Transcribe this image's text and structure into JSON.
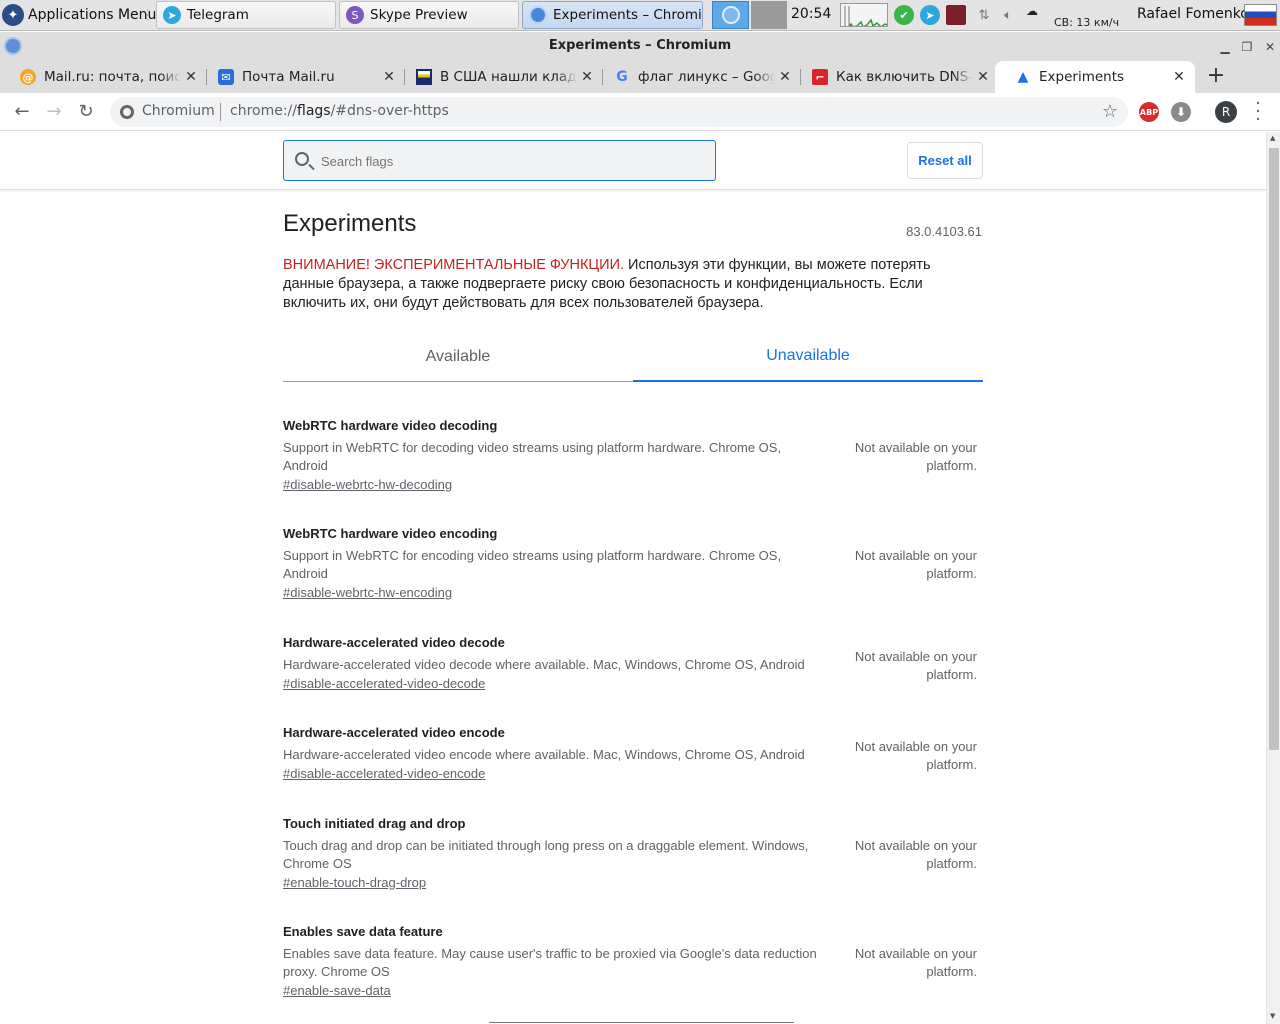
{
  "panel": {
    "app_menu": "Applications Menu",
    "tasks": [
      {
        "label": "Telegram",
        "icon": "telegram-icon"
      },
      {
        "label": "Skype Preview",
        "icon": "skype-icon"
      },
      {
        "label": "Experiments – Chromi...",
        "icon": "chromium-icon"
      }
    ],
    "clock": "20:54",
    "weather": "СВ: 13 км/ч",
    "user": "Rafael Fomenko"
  },
  "window": {
    "title": "Experiments – Chromium"
  },
  "tabs": [
    {
      "label": "Mail.ru: почта, поиск в интернете",
      "icon": "mailru-icon"
    },
    {
      "label": "Почта Mail.ru",
      "icon": "mail-envelope-icon"
    },
    {
      "label": "В США нашли клад на",
      "icon": "news-icon"
    },
    {
      "label": "флаг линукс – Google",
      "icon": "google-icon"
    },
    {
      "label": "Как включить DNS-over-HTTPS",
      "icon": "article-icon"
    },
    {
      "label": "Experiments",
      "icon": "flask-icon",
      "active": true
    }
  ],
  "toolbar": {
    "site": "Chromium",
    "url_prefix": "chrome://",
    "url_host": "flags",
    "url_rest": "/#dns-over-https",
    "avatar_letter": "R",
    "adblock": "ABP"
  },
  "flags_page": {
    "search_placeholder": "Search flags",
    "reset_label": "Reset all",
    "title": "Experiments",
    "version": "83.0.4103.61",
    "warning_red": "ВНИМАНИЕ! ЭКСПЕРИМЕНТАЛЬНЫЕ ФУНКЦИИ.",
    "warning_text": " Используя эти функции, вы можете потерять данные браузера, а также подвергаете риску свою безопасность и конфиденциальность. Если включить их, они будут действовать для всех пользователей браузера.",
    "tab_available": "Available",
    "tab_unavailable": "Unavailable",
    "flags": [
      {
        "name": "WebRTC hardware video decoding",
        "description": "Support in WebRTC for decoding video streams using platform hardware. Chrome OS, Android",
        "link": "#disable-webrtc-hw-decoding",
        "status": "Not available on your platform."
      },
      {
        "name": "WebRTC hardware video encoding",
        "description": "Support in WebRTC for encoding video streams using platform hardware. Chrome OS, Android",
        "link": "#disable-webrtc-hw-encoding",
        "status": "Not available on your platform."
      },
      {
        "name": "Hardware-accelerated video decode",
        "description": "Hardware-accelerated video decode where available. Mac, Windows, Chrome OS, Android",
        "link": "#disable-accelerated-video-decode",
        "status": "Not available on your platform."
      },
      {
        "name": "Hardware-accelerated video encode",
        "description": "Hardware-accelerated video encode where available. Mac, Windows, Chrome OS, Android",
        "link": "#disable-accelerated-video-encode",
        "status": "Not available on your platform."
      },
      {
        "name": "Touch initiated drag and drop",
        "description": "Touch drag and drop can be initiated through long press on a draggable element. Windows, Chrome OS",
        "link": "#enable-touch-drag-drop",
        "status": "Not available on your platform."
      },
      {
        "name": "Enables save data feature",
        "description": "Enables save data feature. May cause user's traffic to be proxied via Google's data reduction proxy. Chrome OS",
        "link": "#enable-save-data",
        "status": "Not available on your platform."
      }
    ]
  },
  "colors": {
    "accent": "#1a73e8",
    "warning": "#c5221f"
  }
}
